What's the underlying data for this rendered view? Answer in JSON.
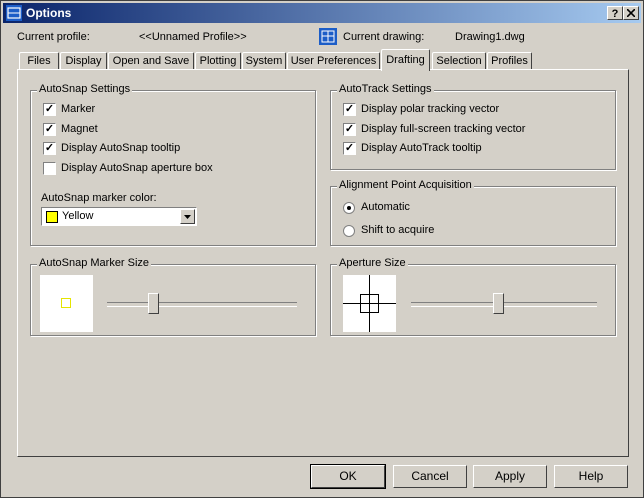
{
  "window": {
    "title": "Options",
    "help_button": "?",
    "close_button": "X"
  },
  "profile": {
    "label": "Current profile:",
    "value": "<<Unnamed Profile>>"
  },
  "drawing": {
    "label": "Current drawing:",
    "value": "Drawing1.dwg"
  },
  "tabs": [
    {
      "label": "Files"
    },
    {
      "label": "Display"
    },
    {
      "label": "Open and Save"
    },
    {
      "label": "Plotting"
    },
    {
      "label": "System"
    },
    {
      "label": "User Preferences"
    },
    {
      "label": "Drafting"
    },
    {
      "label": "Selection"
    },
    {
      "label": "Profiles"
    }
  ],
  "active_tab": "Drafting",
  "autosnap": {
    "title": "AutoSnap Settings",
    "items": [
      {
        "label": "Marker",
        "checked": true
      },
      {
        "label": "Magnet",
        "checked": true
      },
      {
        "label": "Display AutoSnap tooltip",
        "checked": true
      },
      {
        "label": "Display AutoSnap aperture box",
        "checked": false
      }
    ],
    "color_label": "AutoSnap marker color:",
    "color_value": "Yellow",
    "color_swatch": "#ffff00"
  },
  "autotrack": {
    "title": "AutoTrack Settings",
    "items": [
      {
        "label": "Display polar tracking vector",
        "checked": true
      },
      {
        "label": "Display full-screen tracking vector",
        "checked": true
      },
      {
        "label": "Display AutoTrack tooltip",
        "checked": true
      }
    ]
  },
  "alignment": {
    "title": "Alignment Point Acquisition",
    "options": [
      {
        "label": "Automatic",
        "selected": true
      },
      {
        "label": "Shift to acquire",
        "selected": false
      }
    ]
  },
  "marker_size": {
    "title": "AutoSnap Marker Size",
    "slider_fraction": 0.23
  },
  "aperture_size": {
    "title": "Aperture Size",
    "slider_fraction": 0.47
  },
  "buttons": {
    "ok": "OK",
    "cancel": "Cancel",
    "apply": "Apply",
    "help": "Help"
  },
  "colors": {
    "titlebar_start": "#0a246a",
    "titlebar_end": "#a6caf0",
    "face": "#d4d0c8"
  }
}
